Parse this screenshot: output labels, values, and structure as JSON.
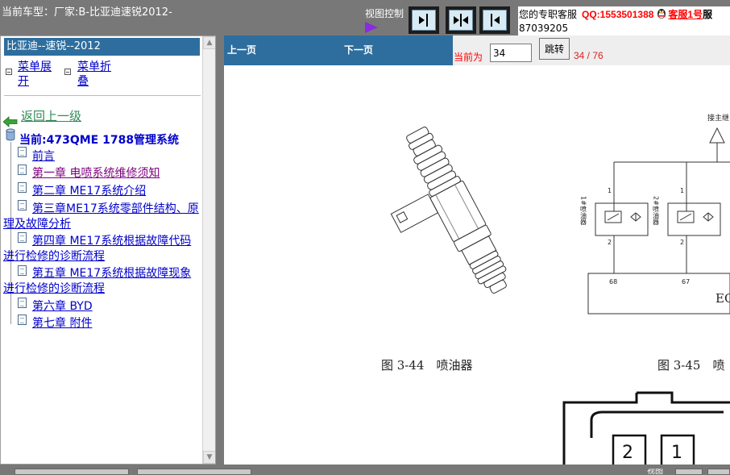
{
  "topbar": {
    "vehicle_label": "当前车型：厂家:B-比亚迪速锐2012-",
    "view_control_label": "视图控制",
    "service_label": "您的专职客服",
    "qq_label": "QQ:1553501388",
    "kefu_link": "客服1号",
    "kefu_tail": "服",
    "qq_second_line": "87039205",
    "view_buttons": [
      "right-panel-icon",
      "split-view-icon",
      "left-panel-icon"
    ]
  },
  "tree": {
    "header": "比亚迪--速锐--2012",
    "expand_menu": "菜单展开",
    "collapse_menu": "菜单折叠",
    "back_link": "返回上一级",
    "current": "当前:473QME 1788管理系统",
    "chapters": [
      {
        "label": "前言"
      },
      {
        "label": "第一章 电喷系统维修须知"
      },
      {
        "label": "第二章 ME17系统介绍"
      },
      {
        "label": "第三章ME17系统零部件结构、原理及故障分析"
      },
      {
        "label": "第四章 ME17系统根据故障代码进行检修的诊断流程"
      },
      {
        "label": "第五章 ME17系统根据故障现象进行检修的诊断流程"
      },
      {
        "label": "第六章 BYD"
      },
      {
        "label": "第七章 附件"
      }
    ]
  },
  "pager": {
    "prev": "上一页",
    "next": "下一页",
    "current_label": "当前为",
    "page_value": "34",
    "jump_button": "跳转",
    "page_count": "34 / 76"
  },
  "content": {
    "figure1_caption": "图 3-44　喷油器",
    "figure2_caption": "图 3-45　喷",
    "diagram_top_label": "接主继",
    "injector1_label": "1#喷油器",
    "injector2_label": "2#喷油器",
    "pin1": "1",
    "pin2": "2",
    "ecu_pin1": "68",
    "ecu_pin2": "67",
    "ecu_label": "EC",
    "connector_pin1": "2",
    "connector_pin2": "1"
  },
  "bottombar": {
    "view_label": "视图"
  }
}
